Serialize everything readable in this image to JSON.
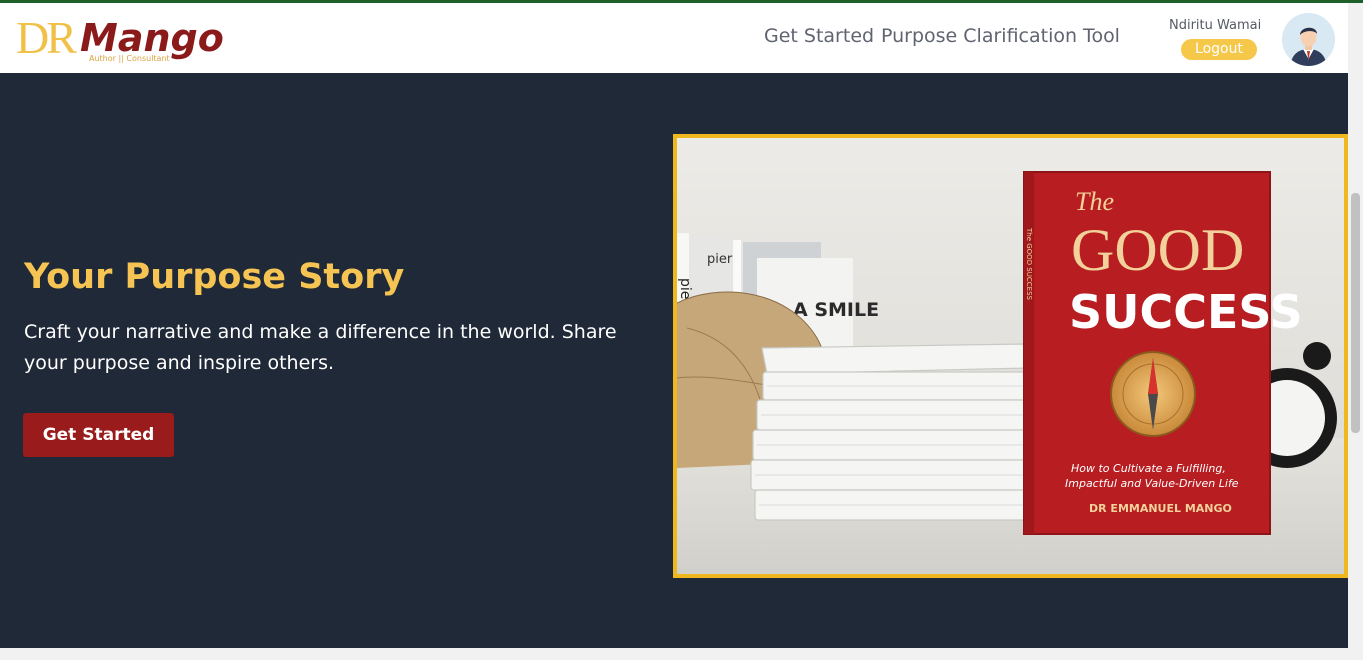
{
  "brand": {
    "logo_dr": "DR",
    "logo_name": "Mango",
    "logo_tagline": "Author || Consultant"
  },
  "nav": {
    "get_started": "Get Started",
    "purpose_tool": "Purpose Clarification Tool"
  },
  "user": {
    "name": "Ndiritu Wamai",
    "logout_label": "Logout",
    "avatar_icon": "user-avatar-icon"
  },
  "hero": {
    "title": "Your Purpose Story",
    "description": "Craft your narrative and make a difference in the world. Share your purpose and inspire others.",
    "cta_label": "Get Started",
    "book": {
      "title_the": "The",
      "title_good": "GOOD",
      "title_success": "SUCCESS",
      "subtitle_line1": "How to Cultivate a Fulfilling,",
      "subtitle_line2": "Impactful and Value-Driven Life",
      "author": "DR EMMANUEL MANGO",
      "spine_text": "The GOOD SUCCESS",
      "background_book_text1": "A SMILE",
      "background_book_text2": "pierre",
      "background_book_text3": "pier"
    }
  },
  "colors": {
    "accent_yellow": "#f6c453",
    "brand_red": "#991b1b",
    "hero_bg": "#1f2937",
    "frame_gold": "#f0b81f"
  }
}
